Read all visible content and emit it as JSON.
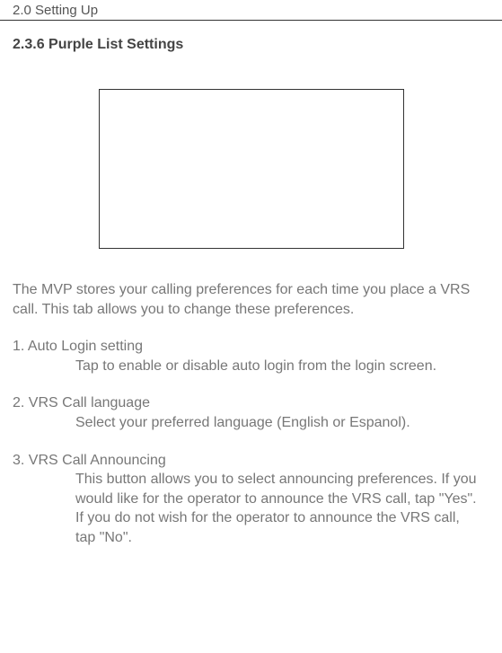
{
  "header": {
    "breadcrumb": "2.0 Setting Up"
  },
  "section": {
    "title": "2.3.6 Purple List Settings"
  },
  "intro": "The MVP stores your calling preferences for each time you place a VRS call.  This tab allows you to change these preferences.",
  "items": [
    {
      "title": "1. Auto Login setting",
      "desc": "Tap to enable or disable auto login from the login screen."
    },
    {
      "title": "2. VRS Call language",
      "desc": "Select your preferred language (English or Espanol)."
    },
    {
      "title": "3. VRS Call Announcing",
      "desc": "This button allows you to select announcing preferences.  If you would like for the operator to announce the VRS call, tap \"Yes\".  If you do not wish for the operator to announce the VRS call, tap \"No\"."
    }
  ]
}
